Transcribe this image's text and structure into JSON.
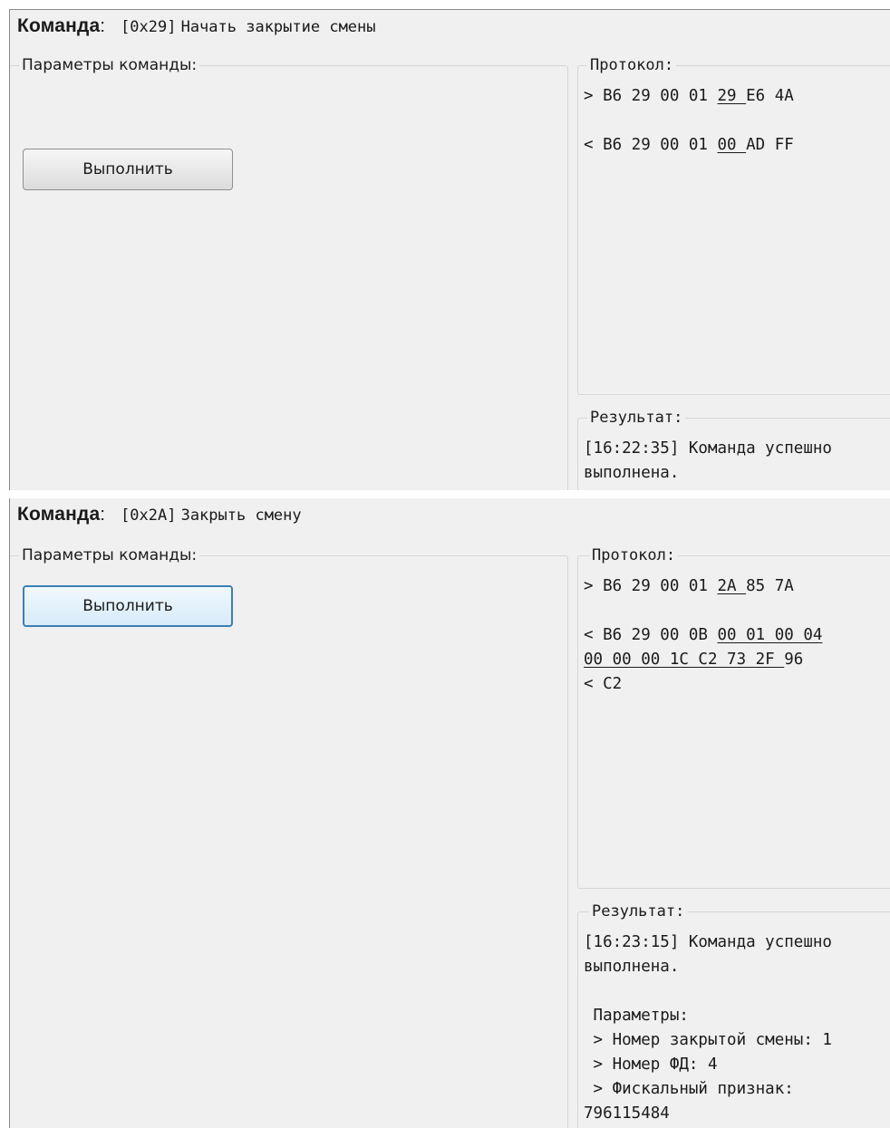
{
  "panels": [
    {
      "command_label": "Команда",
      "command_code": "[0x29]",
      "command_text": "Начать закрытие смены",
      "params_title": "Параметры команды:",
      "execute_label": "Выполнить",
      "protocol_title": "Протокол:",
      "protocol_lines": [
        [
          {
            "t": "> B6 29 00 01 "
          },
          {
            "t": "29 ",
            "u": true
          },
          {
            "t": "E6 4A"
          }
        ],
        [
          {
            "t": ""
          }
        ],
        [
          {
            "t": "< B6 29 00 01 "
          },
          {
            "t": "00 ",
            "u": true
          },
          {
            "t": "AD FF"
          }
        ]
      ],
      "result_title": "Результат:",
      "result_lines": [
        "[16:22:35] Команда успешно",
        "выполнена."
      ]
    },
    {
      "command_label": "Команда",
      "command_code": "[0x2A]",
      "command_text": "Закрыть смену",
      "params_title": "Параметры команды:",
      "execute_label": "Выполнить",
      "protocol_title": "Протокол:",
      "protocol_lines": [
        [
          {
            "t": "> B6 29 00 01 "
          },
          {
            "t": "2A ",
            "u": true
          },
          {
            "t": "85 7A"
          }
        ],
        [
          {
            "t": ""
          }
        ],
        [
          {
            "t": "< B6 29 00 0B "
          },
          {
            "t": "00 01 00 04",
            "u": true
          }
        ],
        [
          {
            "t": "00 00 00 1C C2 73 2F ",
            "u": true
          },
          {
            "t": "96"
          }
        ],
        [
          {
            "t": "< C2"
          }
        ]
      ],
      "result_title": "Результат:",
      "result_lines": [
        "[16:23:15] Команда успешно",
        "выполнена.",
        "",
        " Параметры:",
        " > Номер закрытой смены: 1",
        " > Номер ФД: 4",
        " > Фискальный признак:",
        "796115484"
      ]
    }
  ]
}
